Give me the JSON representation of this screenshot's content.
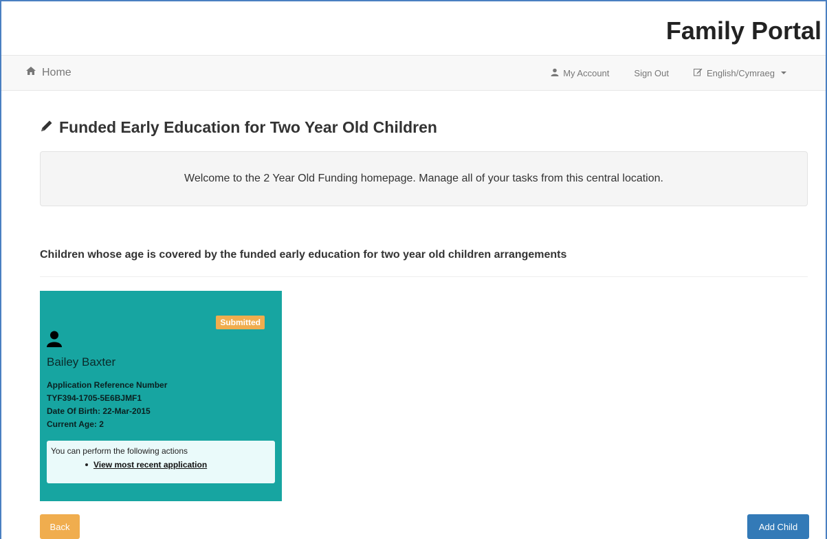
{
  "brand": {
    "title": "Family Portal"
  },
  "nav": {
    "home_label": "Home",
    "my_account_label": "My Account",
    "sign_out_label": "Sign Out",
    "language_label": "English/Cymraeg"
  },
  "page": {
    "title": "Funded Early Education for Two Year Old Children",
    "welcome": "Welcome to the 2 Year Old Funding homepage. Manage all of your tasks from this central location.",
    "section_heading": "Children whose age is covered by the funded early education for two year old children arrangements"
  },
  "child": {
    "status": "Submitted",
    "name": "Bailey Baxter",
    "ref_label": "Application Reference Number",
    "ref_number": "TYF394-1705-5E6BJMF1",
    "dob": "Date Of Birth: 22-Mar-2015",
    "age": "Current Age: 2",
    "actions_intro": "You can perform the following actions",
    "action_view": "View most recent application"
  },
  "buttons": {
    "back_label": "Back",
    "add_child_label": "Add Child"
  },
  "colors": {
    "card": "#17a5a1",
    "badge": "#f0ad4e",
    "back_button": "#f0ad4e",
    "add_button": "#337ab7"
  },
  "icons": {
    "home": "home-icon",
    "account": "user-icon",
    "language": "edit-icon",
    "title": "pencil-icon",
    "child": "person-icon"
  }
}
